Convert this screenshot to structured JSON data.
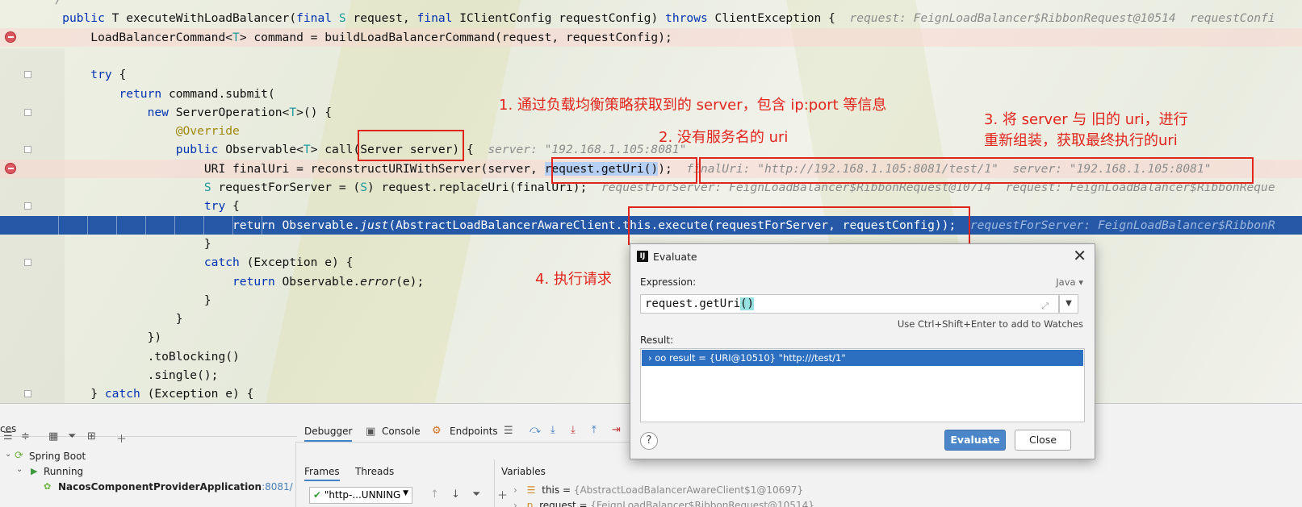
{
  "editor": {
    "lines": [
      {
        "id": "l0",
        "html": "<span class=\"cmt\">  */</span>"
      },
      {
        "id": "l1",
        "text": "    public T executeWithLoadBalancer(final S request, final IClientConfig requestConfig) throws ClientException {",
        "hint": "request: FeignLoadBalancer$RibbonRequest@10514  requestConfi"
      },
      {
        "id": "l2",
        "text": "        LoadBalancerCommand<T> command = buildLoadBalancerCommand(request, requestConfig);"
      },
      {
        "id": "l3",
        "text": ""
      },
      {
        "id": "l4",
        "text": "        try {"
      },
      {
        "id": "l5",
        "text": "            return command.submit("
      },
      {
        "id": "l6",
        "text": "                new ServerOperation<T>() {"
      },
      {
        "id": "l7",
        "text": "                    @Override"
      },
      {
        "id": "l8",
        "text": "                    public Observable<T> call(Server server) {",
        "hint": "server: \"192.168.1.105:8081\""
      },
      {
        "id": "l9",
        "text": "                        URI finalUri = reconstructURIWithServer(server, request.getUri());",
        "hint": "finalUri: \"http://192.168.1.105:8081/test/1\"  server: \"192.168.1.105:8081\""
      },
      {
        "id": "l10",
        "text": "                        S requestForServer = (S) request.replaceUri(finalUri);",
        "hint": "requestForServer: FeignLoadBalancer$RibbonRequest@10714  request: FeignLoadBalancer$RibbonReque"
      },
      {
        "id": "l11",
        "text": "                        try {"
      },
      {
        "id": "l12",
        "text": "                            return Observable.just(AbstractLoadBalancerAwareClient.this.execute(requestForServer, requestConfig));",
        "hint": "requestForServer: FeignLoadBalancer$RibbonR"
      },
      {
        "id": "l13",
        "text": "                        }"
      },
      {
        "id": "l14",
        "text": "                        catch (Exception e) {"
      },
      {
        "id": "l15",
        "text": "                            return Observable.error(e);"
      },
      {
        "id": "l16",
        "text": "                        }"
      },
      {
        "id": "l17",
        "text": "                    }"
      },
      {
        "id": "l18",
        "text": "                })"
      },
      {
        "id": "l19",
        "text": "                .toBlocking()"
      },
      {
        "id": "l20",
        "text": "                .single();"
      },
      {
        "id": "l21",
        "text": "        } catch (Exception e) {"
      }
    ]
  },
  "annotations": {
    "note1": "1. 通过负载均衡策略获取到的 server，包含 ip:port 等信息",
    "note2": "2. 没有服务名的 uri",
    "note3": "3. 将 server 与 旧的 uri，进行\n重新组装，获取最终执行的uri",
    "note4": "4. 执行请求"
  },
  "panel": {
    "services_label": "ces",
    "tree": {
      "spring_boot": "Spring Boot",
      "running": "Running",
      "app": "NacosComponentProviderApplication",
      "app_port": ":8081/"
    },
    "tabs": {
      "debugger": "Debugger",
      "console": "Console",
      "endpoints": "Endpoints"
    },
    "subtabs": {
      "frames": "Frames",
      "threads": "Threads",
      "variables": "Variables"
    },
    "thread_select": "\"http-...UNNING",
    "variables": [
      {
        "name": "this",
        "value": "{AbstractLoadBalancerAwareClient$1@10697}"
      },
      {
        "name": "request",
        "value": "{FeignLoadBalancer$RibbonRequest@10514}"
      }
    ]
  },
  "dialog": {
    "title": "Evaluate",
    "expression_label": "Expression:",
    "language": "Java",
    "expression_prefix": "request.getUri",
    "expression_parens": "()",
    "watch_hint": "Use Ctrl+Shift+Enter to add to Watches",
    "result_label": "Result:",
    "result_text": "result = {URI@10510} \"http:///test/1\"",
    "evaluate_button": "Evaluate",
    "close_button": "Close",
    "help": "?"
  }
}
